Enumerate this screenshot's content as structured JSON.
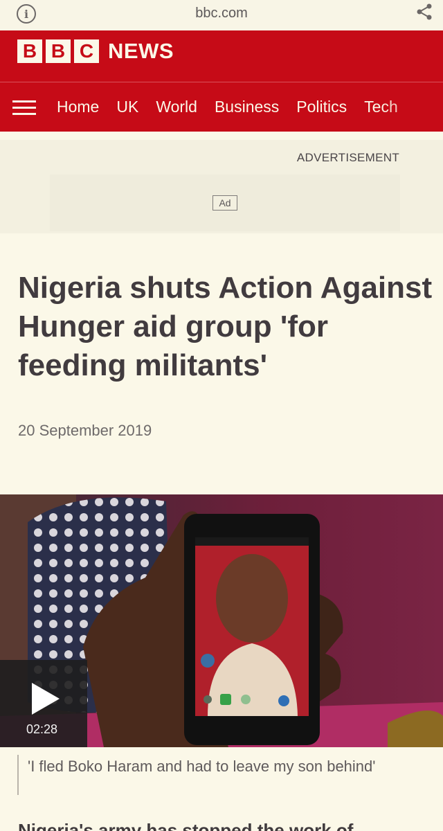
{
  "browser": {
    "url": "bbc.com",
    "info_icon": "info-icon",
    "share_icon": "share-icon"
  },
  "header": {
    "logo_letters": [
      "B",
      "B",
      "C"
    ],
    "logo_word": "NEWS",
    "brand_color": "#c60b17"
  },
  "nav": {
    "menu_icon": "hamburger-icon",
    "items": [
      {
        "label": "Home"
      },
      {
        "label": "UK"
      },
      {
        "label": "World"
      },
      {
        "label": "Business"
      },
      {
        "label": "Politics"
      },
      {
        "label": "Tech"
      }
    ]
  },
  "ad": {
    "label": "ADVERTISEMENT",
    "badge": "Ad"
  },
  "article": {
    "headline": "Nigeria shuts Action Against Hunger aid group 'for feeding militants'",
    "date": "20 September 2019",
    "video": {
      "play_icon": "play-icon",
      "duration": "02:28",
      "caption": "'I fled Boko Haram and had to leave my son behind'"
    },
    "body_start": "Nigeria's army has stopped the work of"
  }
}
